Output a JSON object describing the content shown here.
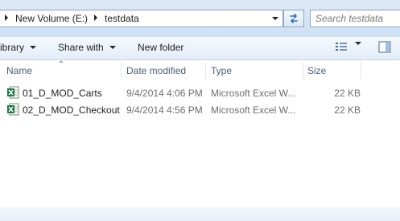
{
  "address_bar": {
    "crumbs": [
      "New Volume (E:)",
      "testdata"
    ]
  },
  "search": {
    "placeholder": "Search testdata"
  },
  "toolbar": {
    "library_label": "ibrary",
    "share_label": "Share with",
    "new_folder_label": "New folder"
  },
  "columns": {
    "name": "Name",
    "date": "Date modified",
    "type": "Type",
    "size": "Size"
  },
  "files": [
    {
      "name": "01_D_MOD_Carts",
      "date": "9/4/2014 4:06 PM",
      "type": "Microsoft Excel W...",
      "size": "22 KB",
      "icon": "excel-file-icon"
    },
    {
      "name": "02_D_MOD_Checkout",
      "date": "9/4/2014 4:56 PM",
      "type": "Microsoft Excel W...",
      "size": "22 KB",
      "icon": "excel-file-icon"
    }
  ],
  "colors": {
    "accent": "#1e7145",
    "header_text": "#4c607a",
    "chrome": "#dde9f6"
  }
}
